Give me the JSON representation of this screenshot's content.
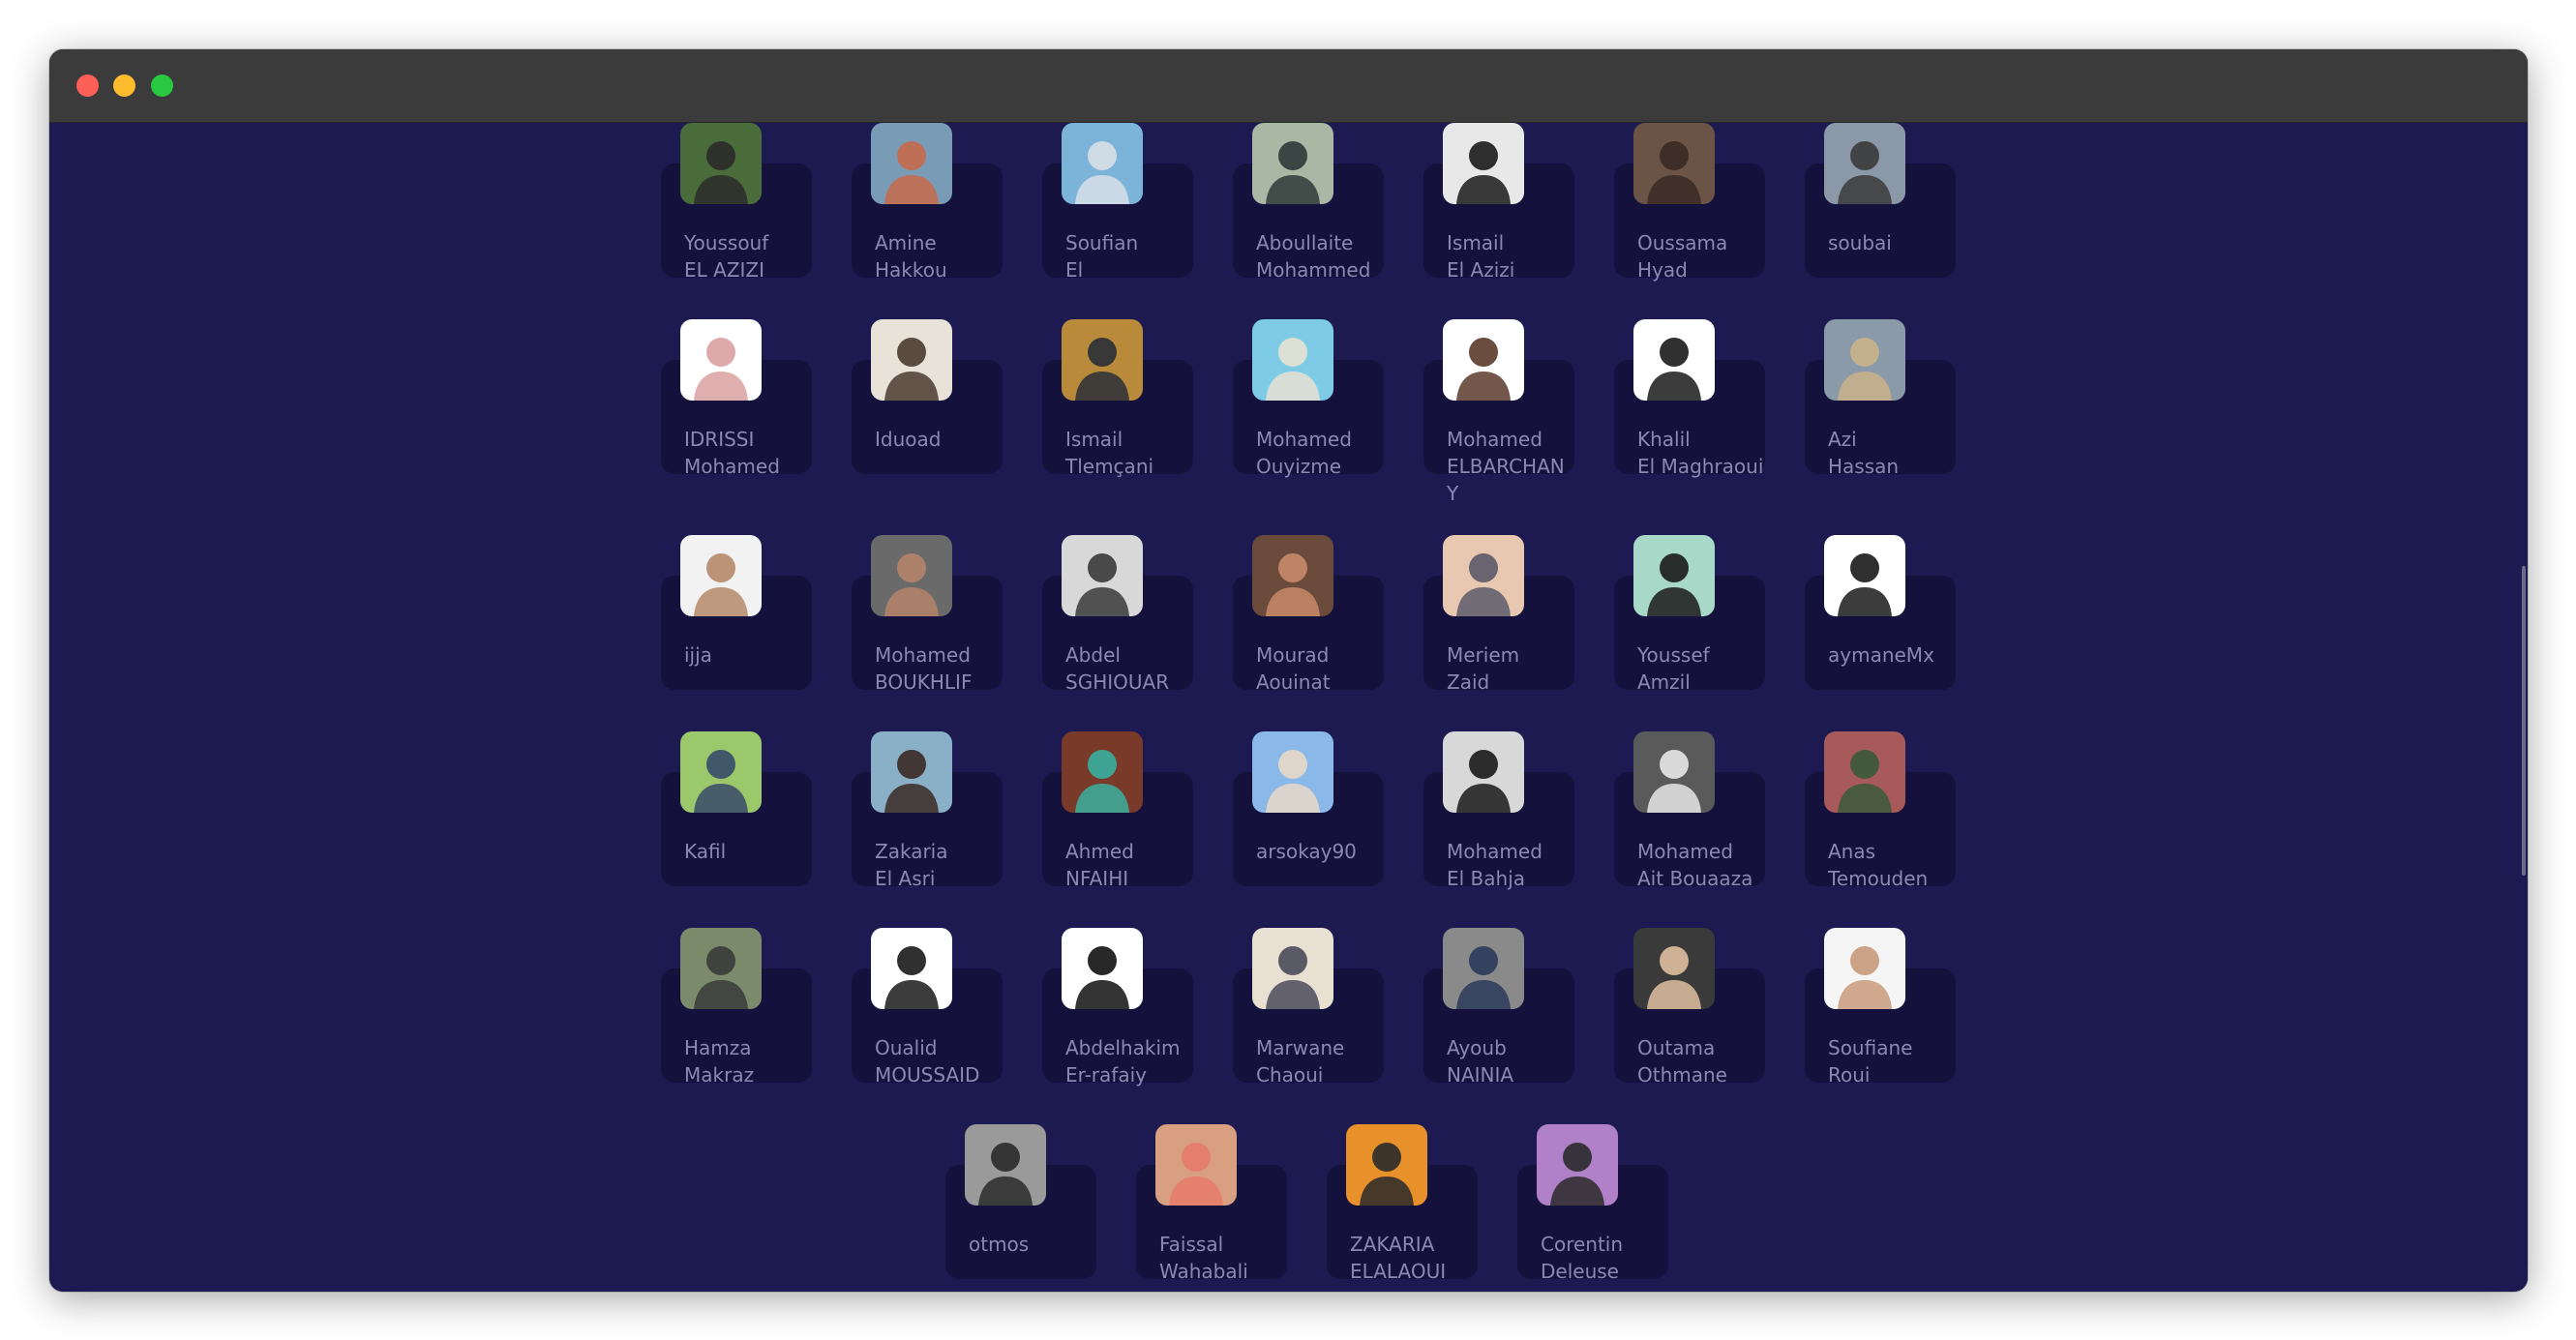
{
  "window": {
    "controls": {
      "close": "close",
      "minimize": "minimize",
      "zoom": "zoom"
    }
  },
  "contributors": [
    {
      "name": "Youssouf\nEL AZIZI",
      "bg": "#4a6b3a",
      "fg": "#2a2a2a"
    },
    {
      "name": "Amine\nHakkou",
      "bg": "#7a9bb5",
      "fg": "#c76a4a"
    },
    {
      "name": "Soufian\nEl",
      "bg": "#7bb3d9",
      "fg": "#d8dfe6"
    },
    {
      "name": "Aboullaite\nMohammed",
      "bg": "#a8b8a4",
      "fg": "#2f3a3a"
    },
    {
      "name": "Ismail\nEl Azizi",
      "bg": "#e8e8e8",
      "fg": "#1a1a1a"
    },
    {
      "name": "Oussama\nHyad",
      "bg": "#6b5345",
      "fg": "#3a2a24"
    },
    {
      "name": "soubai",
      "bg": "#8a98a8",
      "fg": "#3a3a3a"
    },
    {
      "name": "IDRISSI\nMohamed",
      "bg": "#ffffff",
      "fg": "#d9a0a0"
    },
    {
      "name": "Iduoad",
      "bg": "#e8e2d8",
      "fg": "#4a3b2f"
    },
    {
      "name": "Ismail\nTlemçani",
      "bg": "#b88a3a",
      "fg": "#2a2f3a"
    },
    {
      "name": "Mohamed\nOuyizme",
      "bg": "#7ecbe8",
      "fg": "#e8e2d2"
    },
    {
      "name": "Mohamed\nELBARCHAN\nY",
      "bg": "#ffffff",
      "fg": "#5a3a2a"
    },
    {
      "name": "Khalil\nEl Maghraoui",
      "bg": "#ffffff",
      "fg": "#1a1a1a"
    },
    {
      "name": "Azi\nHassan",
      "bg": "#8a9aa8",
      "fg": "#c9b28a"
    },
    {
      "name": "ijja",
      "bg": "#f2f2f2",
      "fg": "#b58a6a"
    },
    {
      "name": "Mohamed\nBOUKHLIF",
      "bg": "#6a6a6a",
      "fg": "#b5846a"
    },
    {
      "name": "Abdel\nSGHIOUAR",
      "bg": "#d8d8d8",
      "fg": "#3a3a3a"
    },
    {
      "name": "Mourad\nAouinat",
      "bg": "#6a4a3a",
      "fg": "#c98a6a"
    },
    {
      "name": "Meriem\nZaid",
      "bg": "#e8c8b0",
      "fg": "#5a5a6a"
    },
    {
      "name": "Youssef\nAmzil",
      "bg": "#a8d8c8",
      "fg": "#1a1a1a"
    },
    {
      "name": "aymaneMx",
      "bg": "#ffffff",
      "fg": "#1a1a1a"
    },
    {
      "name": "Kafil",
      "bg": "#9ac86a",
      "fg": "#3a4a6a"
    },
    {
      "name": "Zakaria\nEl Asri",
      "bg": "#8ab0c8",
      "fg": "#3a2a24"
    },
    {
      "name": "Ahmed\nNFAIHI",
      "bg": "#7a3a2a",
      "fg": "#3ab0a0"
    },
    {
      "name": "arsokay90",
      "bg": "#8ab8e8",
      "fg": "#e8d8c8"
    },
    {
      "name": "Mohamed\nEl Bahja",
      "bg": "#d8d8d8",
      "fg": "#1a1a1a"
    },
    {
      "name": "Mohamed\nAit Bouaaza",
      "bg": "#5a5a5a",
      "fg": "#e8e8e8"
    },
    {
      "name": "Anas\nTemouden",
      "bg": "#a85a5a",
      "fg": "#3a5a3a"
    },
    {
      "name": "Hamza\nMakraz",
      "bg": "#7a8a6a",
      "fg": "#3a3a3a"
    },
    {
      "name": "Oualid\nMOUSSAID",
      "bg": "#ffffff",
      "fg": "#1a1a1a"
    },
    {
      "name": "Abdelhakim\nEr-rafaiy",
      "bg": "#ffffff",
      "fg": "#111111"
    },
    {
      "name": "Marwane\nChaoui",
      "bg": "#e8e0d0",
      "fg": "#4a4a5a"
    },
    {
      "name": "Ayoub\nNAINIA",
      "bg": "#8a8a8a",
      "fg": "#2a3a5a"
    },
    {
      "name": "Outama\nOthmane",
      "bg": "#3a3a3a",
      "fg": "#e0c0a0"
    },
    {
      "name": "Soufiane\nRoui",
      "bg": "#f5f5f5",
      "fg": "#c89a7a"
    },
    {
      "name": "otmos",
      "bg": "#9a9a9a",
      "fg": "#2a2a2a"
    },
    {
      "name": "Faissal\nWahabali",
      "bg": "#d8a080",
      "fg": "#e87a6a"
    },
    {
      "name": "ZAKARIA\nELALAOUI",
      "bg": "#e8902a",
      "fg": "#2a2a2a"
    },
    {
      "name": "Corentin\nDeleuse",
      "bg": "#b080c8",
      "fg": "#2a2a2a"
    }
  ]
}
